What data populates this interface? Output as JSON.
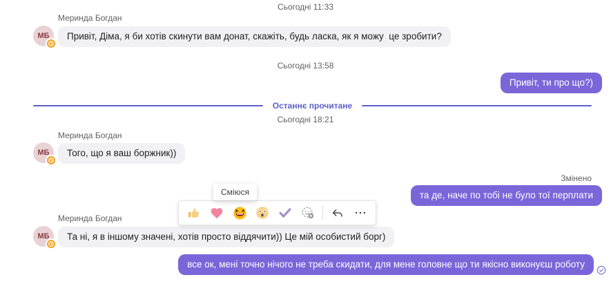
{
  "colors": {
    "accent_purple": "#7b66d9",
    "incoming_bubble": "#f1f1f3",
    "divider_purple": "#5b5fc8",
    "meta_text": "#5f5f5f",
    "avatar_bg": "#e9d2d4",
    "avatar_text": "#8b3a48",
    "away_badge": "#efa11d"
  },
  "contact": {
    "name": "Меринда Богдан",
    "initials": "МБ",
    "status_icon": "away-clock-icon"
  },
  "date_headers": {
    "first": "Сьогодні 11:33",
    "second": "Сьогодні 13:58",
    "third": "Сьогодні 18:21"
  },
  "read_divider": {
    "label": "Останнє прочитане"
  },
  "messages": [
    {
      "direction": "incoming",
      "text": "Привіт, Діма, я би хотів скинути вам донат, скажіть, будь ласка, як я можу  це зробити?"
    },
    {
      "direction": "outgoing",
      "text": "Привіт, ти про що?)"
    },
    {
      "direction": "incoming",
      "text": "Того, що я ваш боржник))"
    },
    {
      "direction": "outgoing",
      "text": "та де, наче по тобі не було тої перплати",
      "edited_label": "Змінено"
    },
    {
      "direction": "incoming",
      "text": "Та ні, я в іншому значені, хотів просто віддячити)) Це мій особистий борг)"
    },
    {
      "direction": "outgoing",
      "text": "все ок, мені точно нічого не треба скидати, для мене головне що ти якісно виконуєш роботу",
      "status": "delivered"
    }
  ],
  "reaction_bar": {
    "tooltip": "Сміюся",
    "reactions": [
      "thumbs-up",
      "heart",
      "laughing",
      "surprised",
      "checkmark",
      "add-reaction"
    ],
    "actions": [
      "reply",
      "more-options"
    ]
  }
}
